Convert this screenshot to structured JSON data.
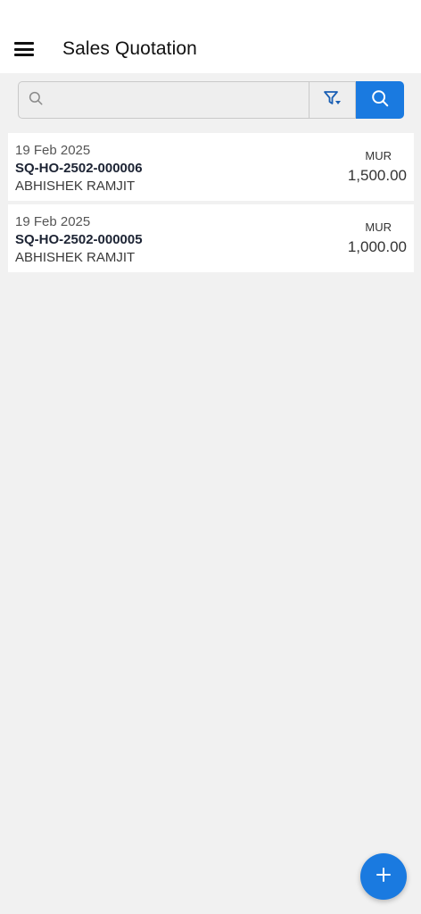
{
  "header": {
    "title": "Sales Quotation"
  },
  "search": {
    "value": "",
    "placeholder": ""
  },
  "icons": {
    "menu": "hamburger-menu-icon",
    "search": "search-icon",
    "filter": "filter-icon",
    "add": "plus-icon"
  },
  "colors": {
    "accent": "#1a7ae0",
    "background": "#f1f1f1"
  },
  "quotations": [
    {
      "date": "19 Feb 2025",
      "number": "SQ-HO-2502-000006",
      "customer": "ABHISHEK RAMJIT",
      "currency": "MUR",
      "amount": "1,500.00"
    },
    {
      "date": "19 Feb 2025",
      "number": "SQ-HO-2502-000005",
      "customer": "ABHISHEK RAMJIT",
      "currency": "MUR",
      "amount": "1,000.00"
    }
  ]
}
